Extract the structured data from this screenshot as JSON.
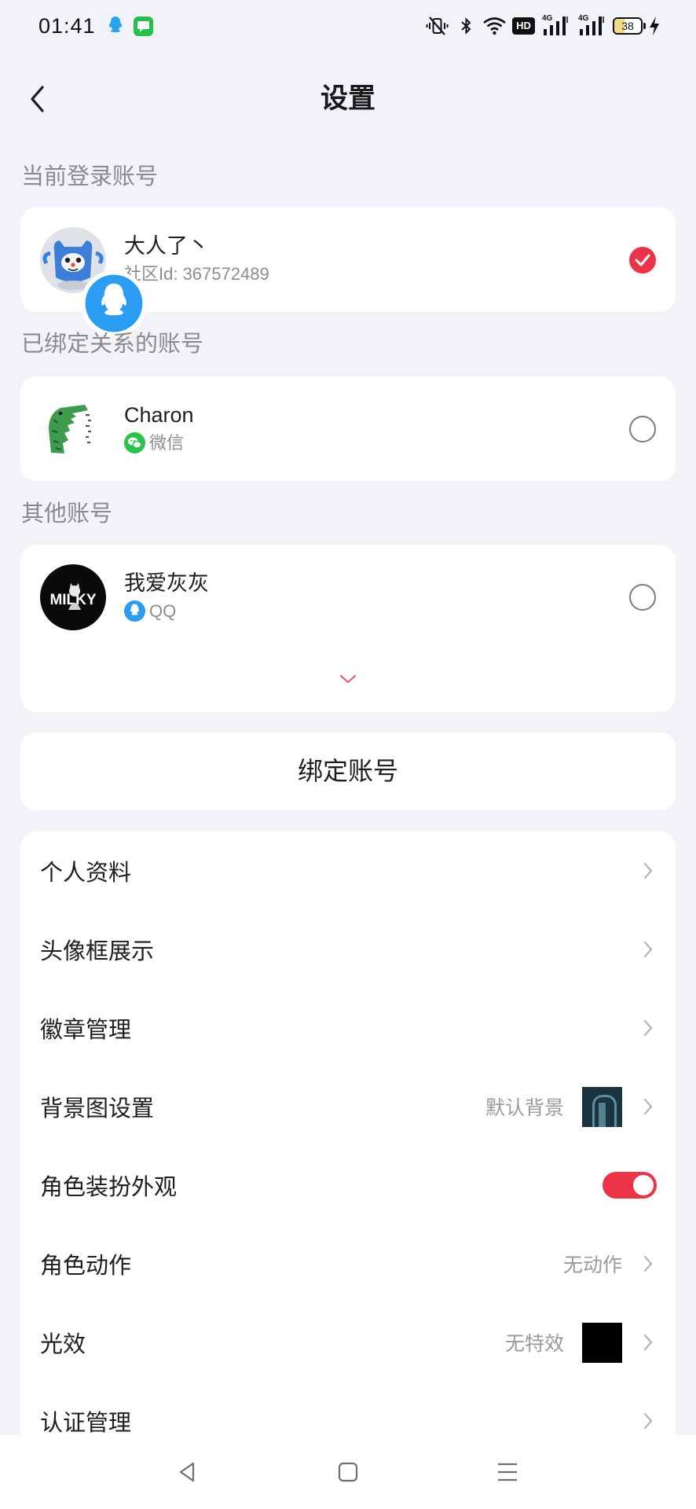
{
  "status_bar": {
    "time": "01:41",
    "notification_icons": [
      "qq-icon",
      "message-icon"
    ],
    "system_icons": [
      "vibrate-mute-icon",
      "bluetooth-icon",
      "wifi-icon",
      "charging-icon"
    ],
    "hd_label": "HD",
    "signal_labels": [
      "4G",
      "4G"
    ],
    "battery_level": "38"
  },
  "header": {
    "back_icon": "chevron-left-icon",
    "title": "设置"
  },
  "current_account": {
    "section_label": "当前登录账号",
    "name": "大人了丶",
    "community_id": "社区Id: 367572489",
    "badge_icon": "qq-icon",
    "selected": true
  },
  "bound_account": {
    "section_label": "已绑定关系的账号",
    "name": "Charon",
    "platform": "微信",
    "platform_icon": "wechat-icon",
    "selected": false
  },
  "other_account": {
    "section_label": "其他账号",
    "name": "我爱灰灰",
    "platform": "QQ",
    "platform_icon": "qq-icon",
    "avatar_logo_text": "MILKY",
    "selected": false,
    "expand_icon": "chevron-down-icon"
  },
  "bind_button": {
    "label": "绑定账号"
  },
  "settings": {
    "rows": [
      {
        "label": "个人资料"
      },
      {
        "label": "头像框展示"
      },
      {
        "label": "徽章管理"
      },
      {
        "label": "背景图设置",
        "value": "默认背景",
        "thumbnail_color": "#1c3340"
      },
      {
        "label": "角色装扮外观",
        "toggle_on": true
      },
      {
        "label": "角色动作",
        "value": "无动作"
      },
      {
        "label": "光效",
        "value": "无特效",
        "thumbnail_color": "#000000"
      },
      {
        "label": "认证管理"
      }
    ]
  },
  "nav_bar": {
    "icons": [
      "back-triangle-icon",
      "home-square-icon",
      "menu-lines-icon"
    ]
  },
  "colors": {
    "background": "#f2f3f8",
    "card": "#ffffff",
    "accent": "#ea3347",
    "wechat": "#29c24a",
    "qq": "#2a9cf2",
    "expand_chevron": "#e26685"
  }
}
